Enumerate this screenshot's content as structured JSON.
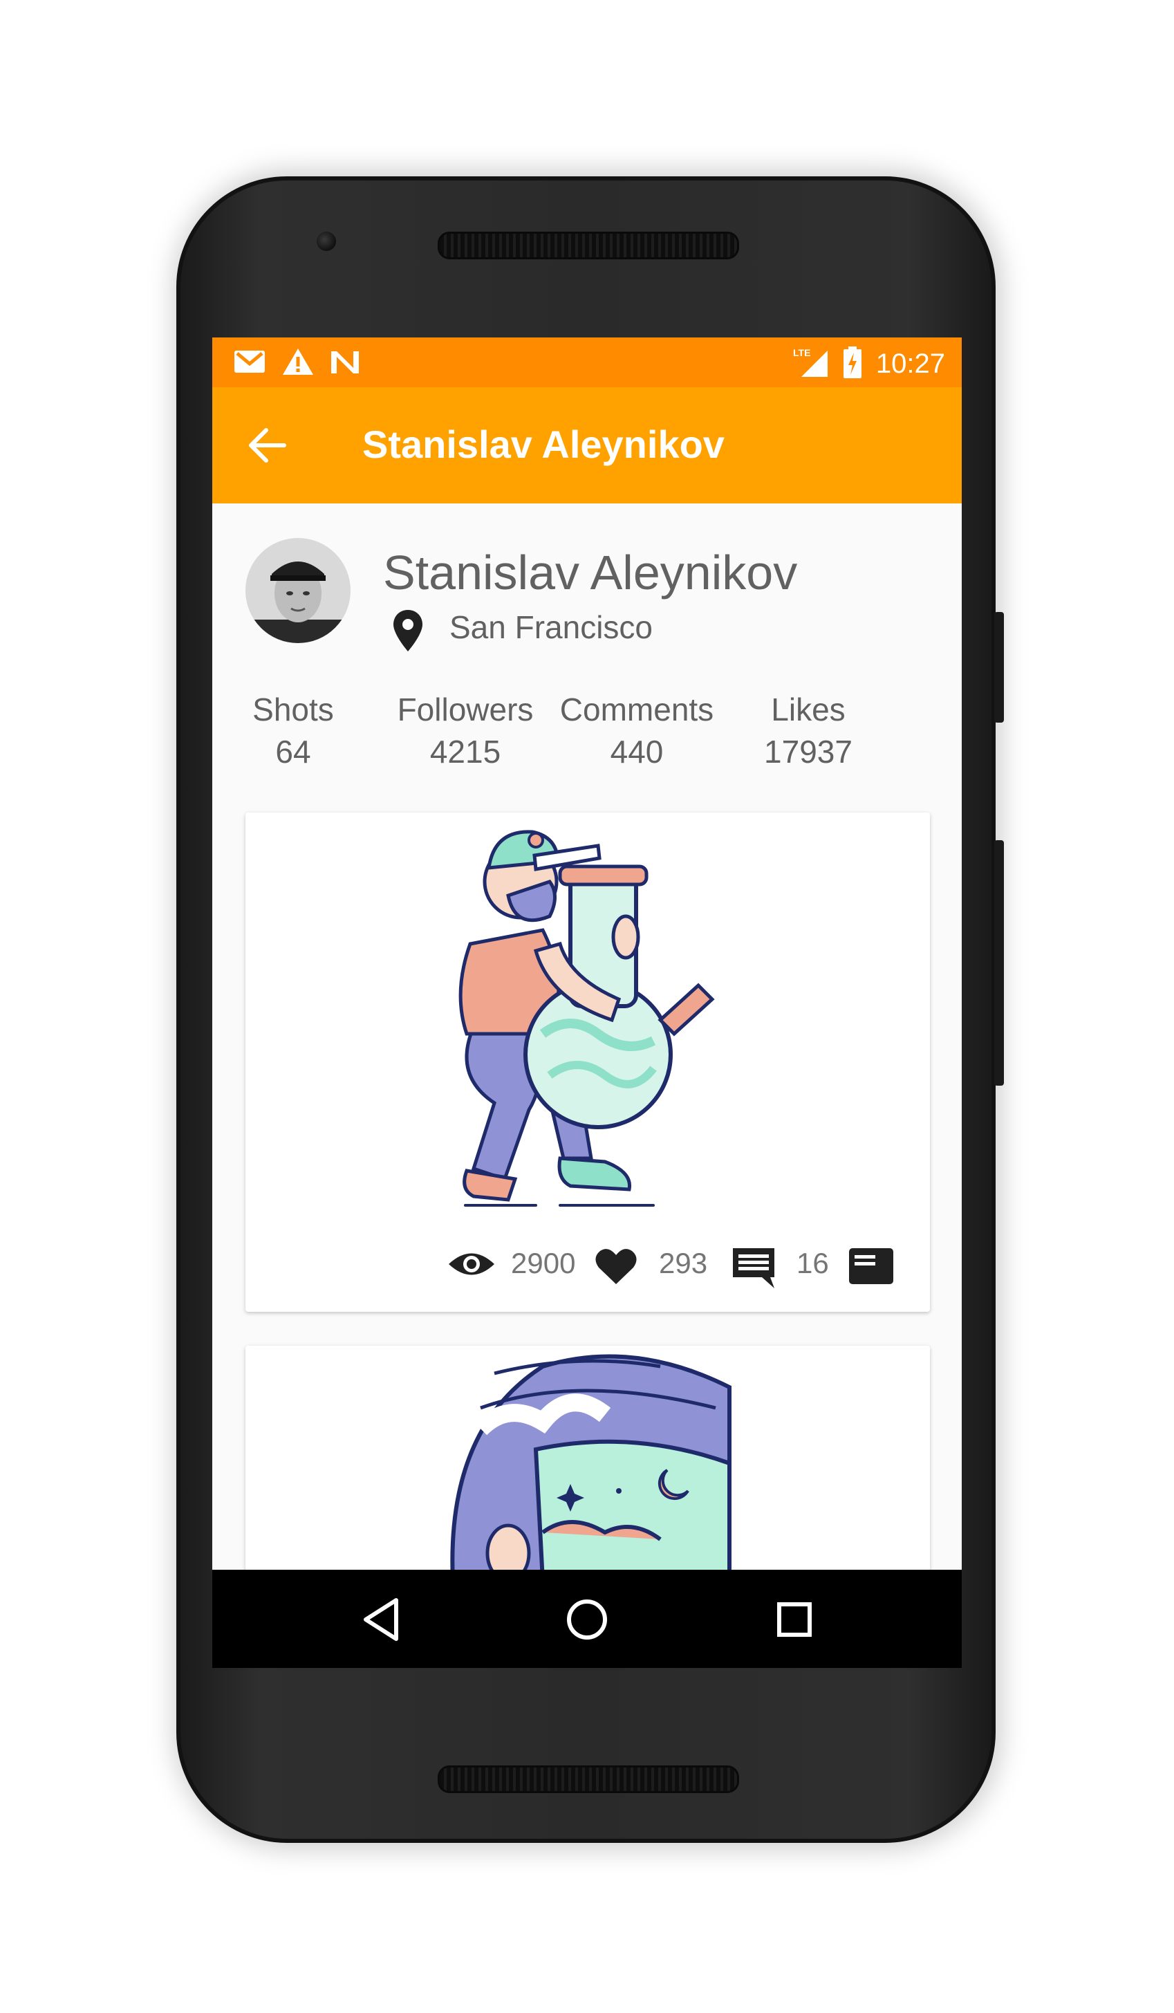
{
  "status_bar": {
    "time": "10:27",
    "icons_left": [
      "gmail-icon",
      "warning-icon",
      "n-icon"
    ],
    "icons_right": [
      "lte-signal-icon",
      "battery-charging-icon"
    ],
    "background": "#ff8c00"
  },
  "app_bar": {
    "title": "Stanislav Aleynikov",
    "back_icon": "arrow-back-icon",
    "background": "#ffa200"
  },
  "profile": {
    "name": "Stanislav Aleynikov",
    "location": "San Francisco",
    "location_icon": "map-pin-icon",
    "stats": [
      {
        "label": "Shots",
        "value": "64"
      },
      {
        "label": "Followers",
        "value": "4215"
      },
      {
        "label": "Comments",
        "value": "440"
      },
      {
        "label": "Likes",
        "value": "17937"
      }
    ]
  },
  "shots": [
    {
      "views": "2900",
      "likes": "293",
      "comments": "16",
      "icons": [
        "eye-icon",
        "heart-icon",
        "comment-icon",
        "bucket-icon"
      ]
    }
  ],
  "nav_bar": {
    "buttons": [
      "back-triangle-icon",
      "home-circle-icon",
      "recents-square-icon"
    ]
  }
}
